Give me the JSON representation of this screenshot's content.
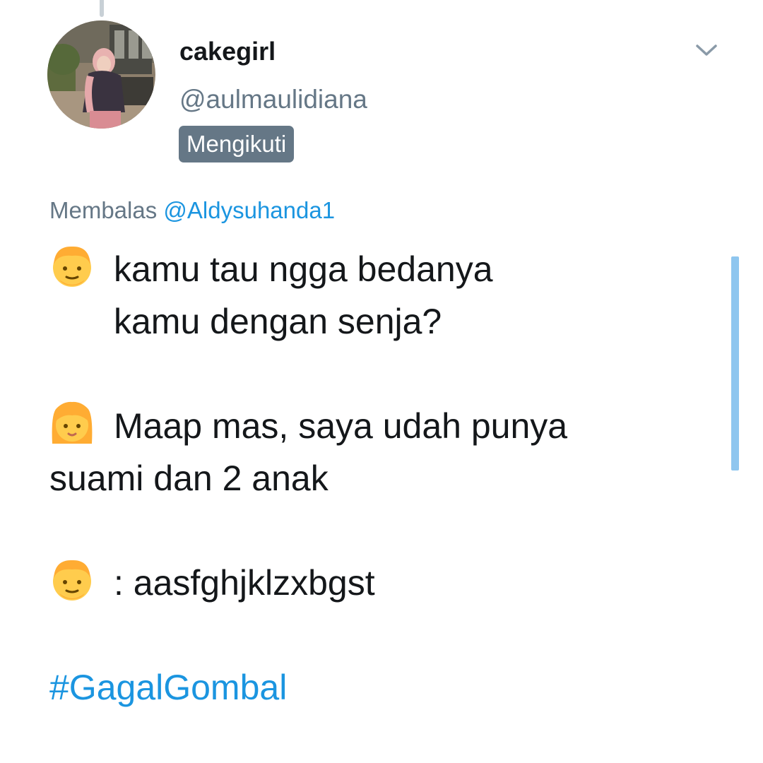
{
  "tweet": {
    "display_name": "cakegirl",
    "handle": "@aulmaulidiana",
    "follow_status": "Mengikuti",
    "reply_prefix": "Membalas",
    "reply_to": "@Aldysuhanda1",
    "lines": [
      {
        "emoji": "man-emoji",
        "text": "kamu tau ngga bedanya"
      },
      {
        "text": "kamu dengan senja?"
      },
      {
        "text": ""
      },
      {
        "emoji": "woman-emoji",
        "text": "Maap mas, saya udah punya"
      },
      {
        "text": "suami dan 2 anak"
      },
      {
        "text": ""
      },
      {
        "emoji": "man-emoji",
        "text": ": aasfghjklzxbgst"
      },
      {
        "text": ""
      }
    ],
    "hashtag": "#GagalGombal"
  },
  "icons": {
    "menu": "chevron-down-icon",
    "avatar": "profile-photo"
  },
  "colors": {
    "link": "#1b95e0",
    "secondary_text": "#657786",
    "primary_text": "#14171a",
    "scrollbar": "#8fc6ef",
    "emoji_yellow": "#ffcc4d",
    "emoji_hair": "#ffac33"
  }
}
